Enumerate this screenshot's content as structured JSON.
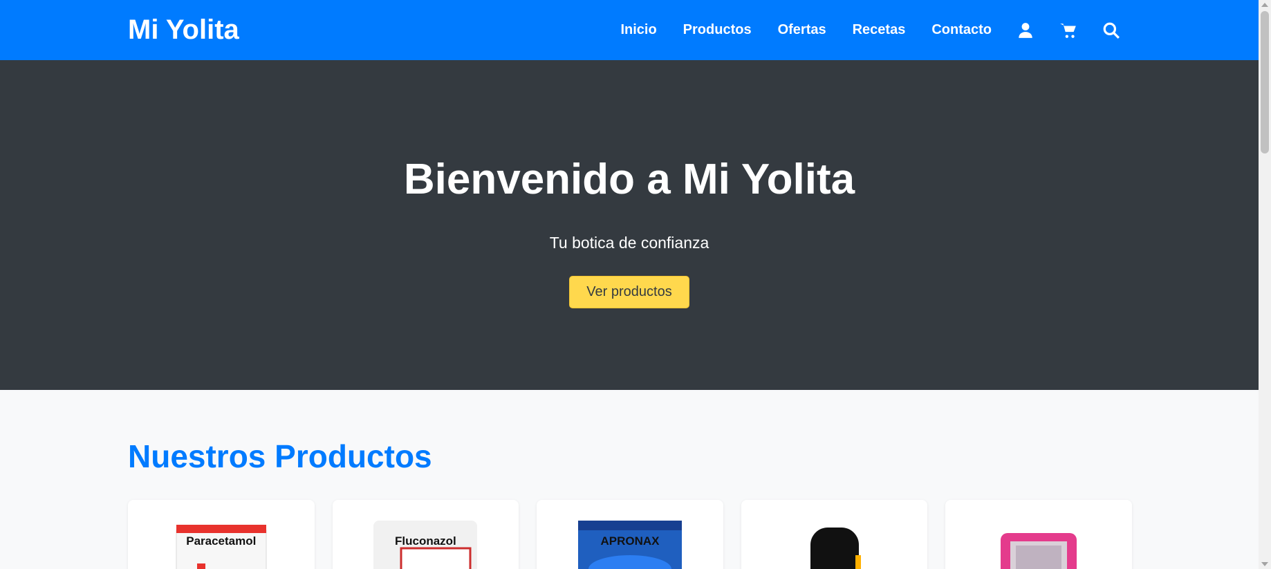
{
  "brand": "Mi Yolita",
  "nav": {
    "links": [
      "Inicio",
      "Productos",
      "Ofertas",
      "Recetas",
      "Contacto"
    ],
    "icons": [
      "user-icon",
      "cart-icon",
      "search-icon"
    ]
  },
  "hero": {
    "title": "Bienvenido a Mi Yolita",
    "subtitle": "Tu botica de confianza",
    "cta": "Ver productos"
  },
  "products": {
    "title": "Nuestros Productos",
    "items": [
      {
        "label": "Paracetamol"
      },
      {
        "label": "Fluconazol"
      },
      {
        "label": "APRONAX"
      },
      {
        "label": ""
      },
      {
        "label": ""
      }
    ]
  },
  "colors": {
    "primary": "#007bff",
    "hero_bg": "#343a40",
    "cta": "#ffd84d"
  }
}
